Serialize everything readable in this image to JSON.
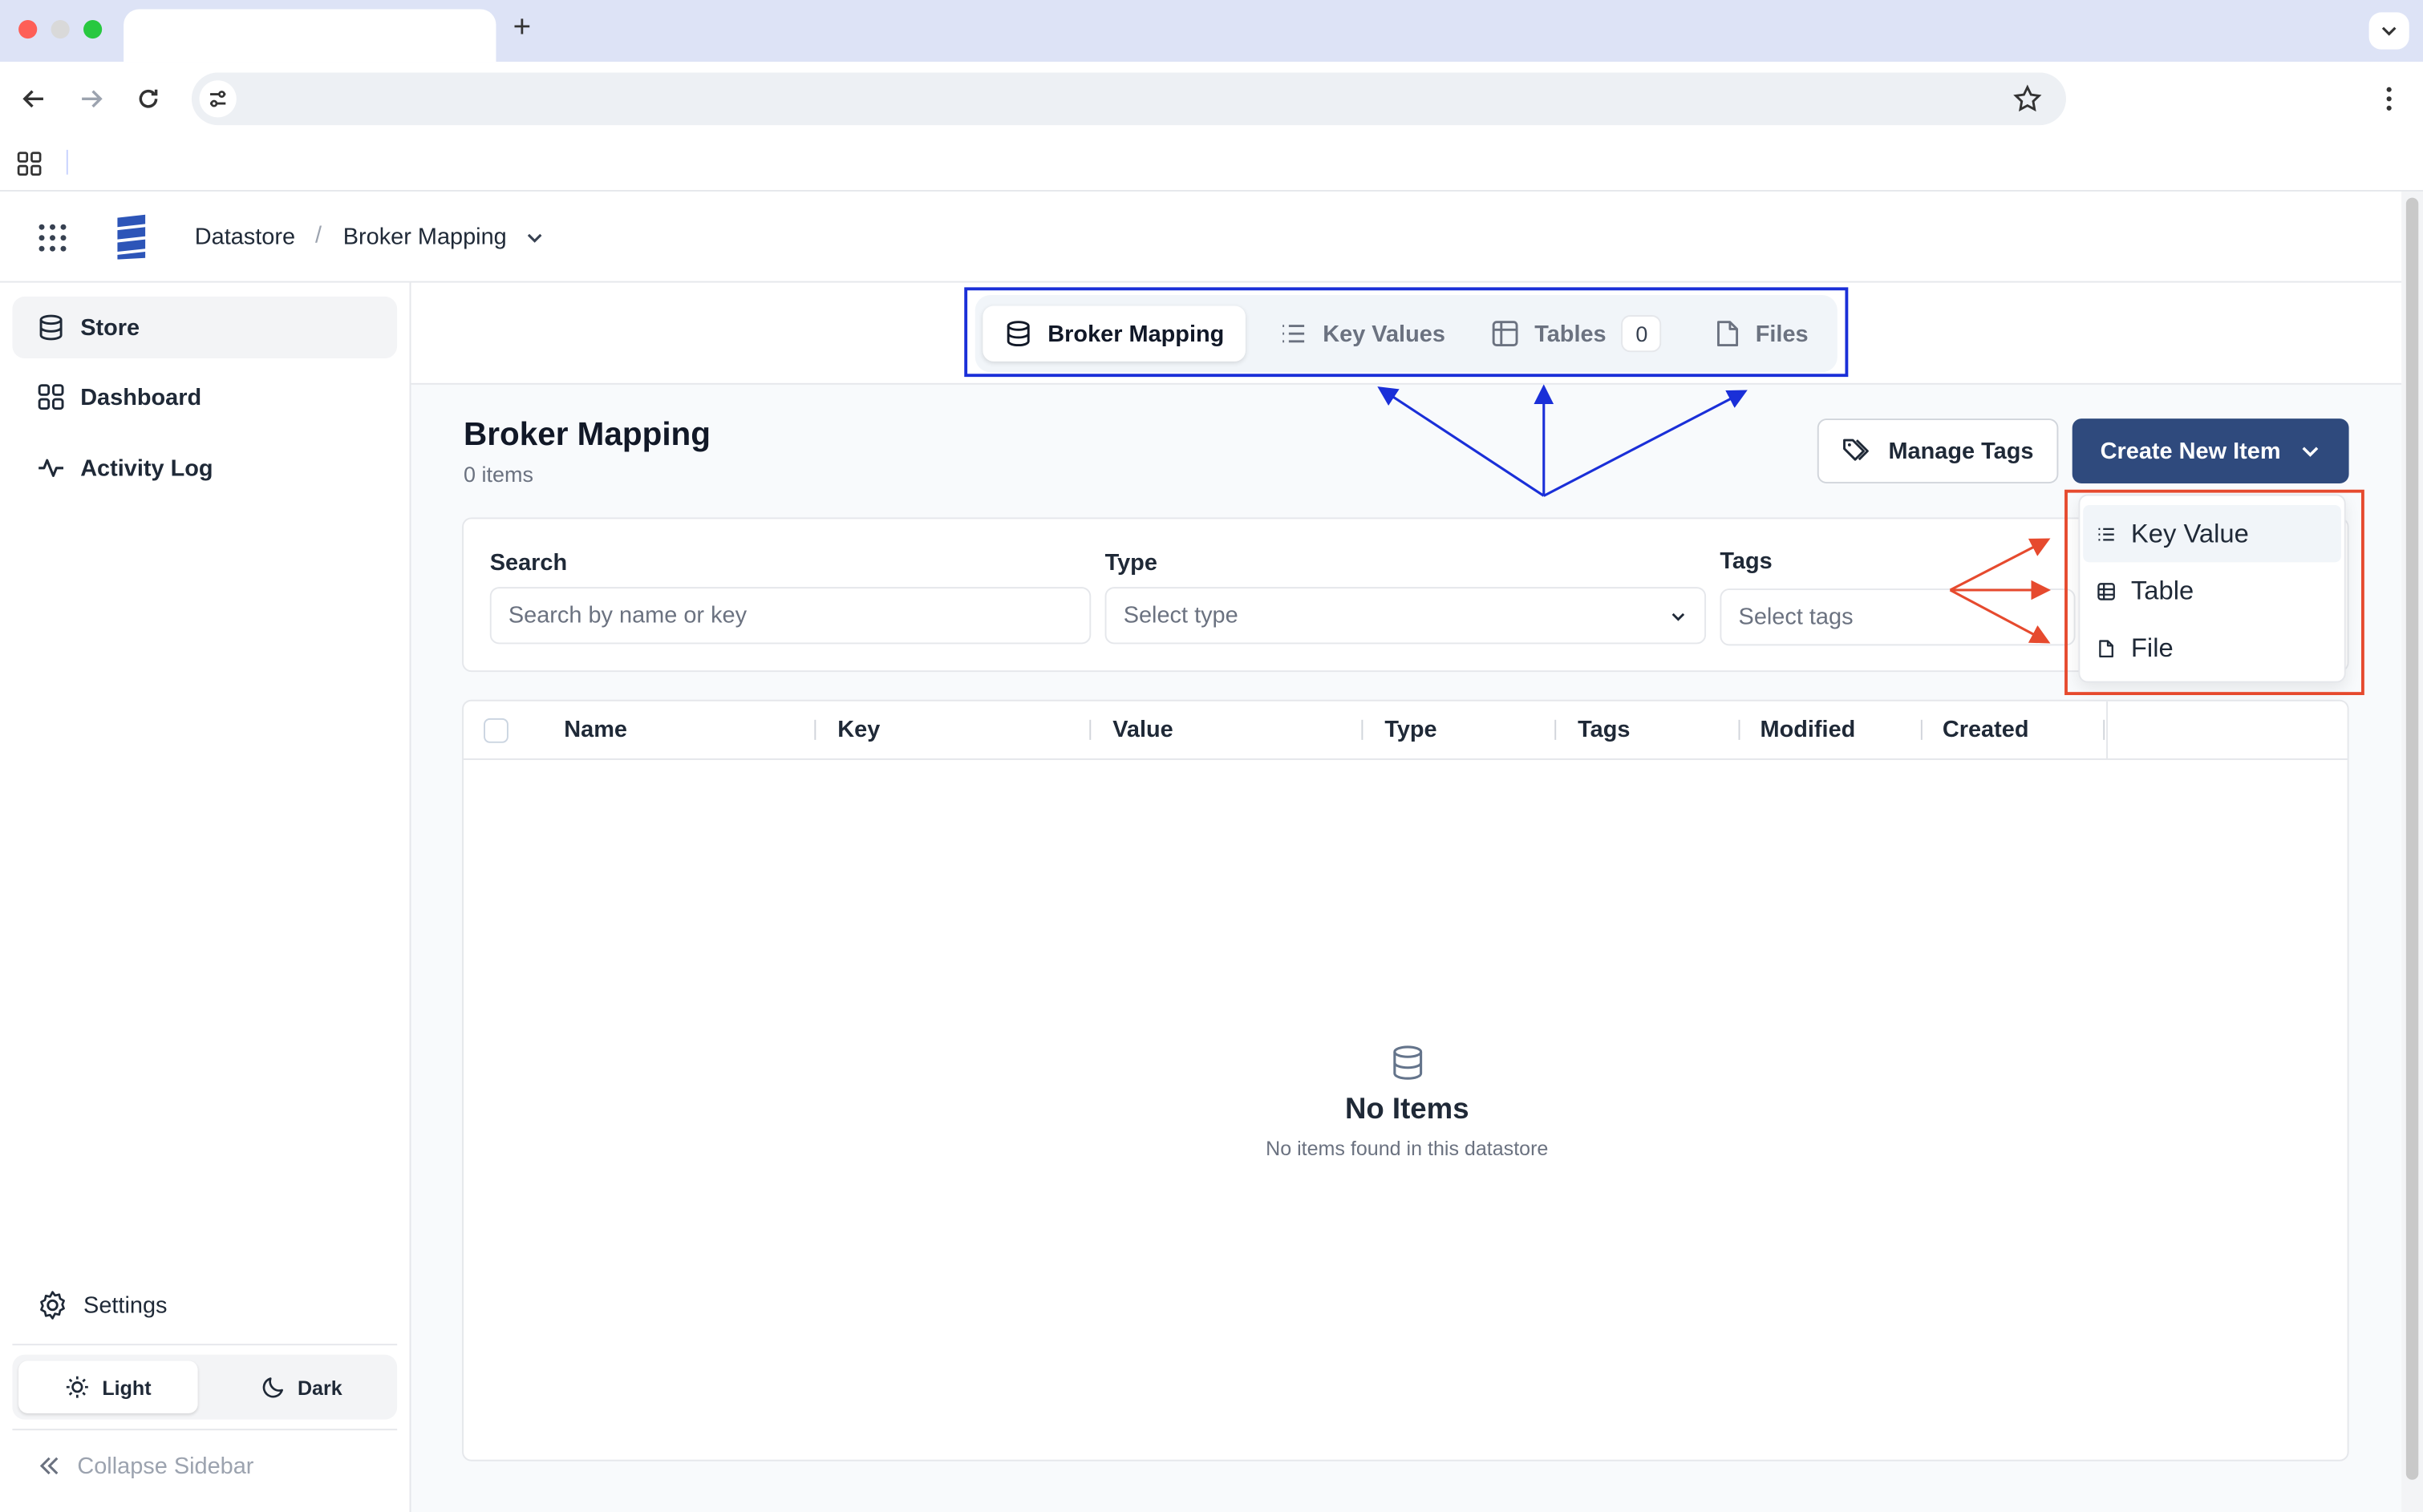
{
  "header": {
    "breadcrumb_root": "Datastore",
    "breadcrumb_separator": "/",
    "breadcrumb_current": "Broker Mapping"
  },
  "sidebar": {
    "items": [
      {
        "label": "Store",
        "icon": "database-icon",
        "active": true
      },
      {
        "label": "Dashboard",
        "icon": "dashboard-icon",
        "active": false
      },
      {
        "label": "Activity Log",
        "icon": "activity-icon",
        "active": false
      }
    ],
    "settings_label": "Settings",
    "theme_light": "Light",
    "theme_dark": "Dark",
    "collapse_label": "Collapse Sidebar"
  },
  "tabs": [
    {
      "label": "Broker Mapping",
      "icon": "database-icon",
      "active": true
    },
    {
      "label": "Key Values",
      "icon": "list-icon",
      "active": false
    },
    {
      "label": "Tables",
      "icon": "table-icon",
      "badge": "0",
      "active": false
    },
    {
      "label": "Files",
      "icon": "file-icon",
      "active": false
    }
  ],
  "page": {
    "title": "Broker Mapping",
    "subtitle": "0 items",
    "manage_tags_label": "Manage Tags",
    "create_label": "Create New Item"
  },
  "filters": {
    "search_label": "Search",
    "search_placeholder": "Search by name or key",
    "type_label": "Type",
    "type_placeholder": "Select type",
    "tags_label": "Tags",
    "tags_placeholder": "Select tags"
  },
  "table": {
    "columns": [
      "Name",
      "Key",
      "Value",
      "Type",
      "Tags",
      "Modified",
      "Created"
    ],
    "empty_title": "No Items",
    "empty_subtitle": "No items found in this datastore"
  },
  "create_menu": {
    "items": [
      {
        "label": "Key Value",
        "icon": "list-icon"
      },
      {
        "label": "Table",
        "icon": "table-icon"
      },
      {
        "label": "File",
        "icon": "file-icon"
      }
    ]
  },
  "colors": {
    "primary": "#2f4a7d",
    "annotation_blue": "#1a2fd8",
    "annotation_red": "#e64a2e"
  }
}
